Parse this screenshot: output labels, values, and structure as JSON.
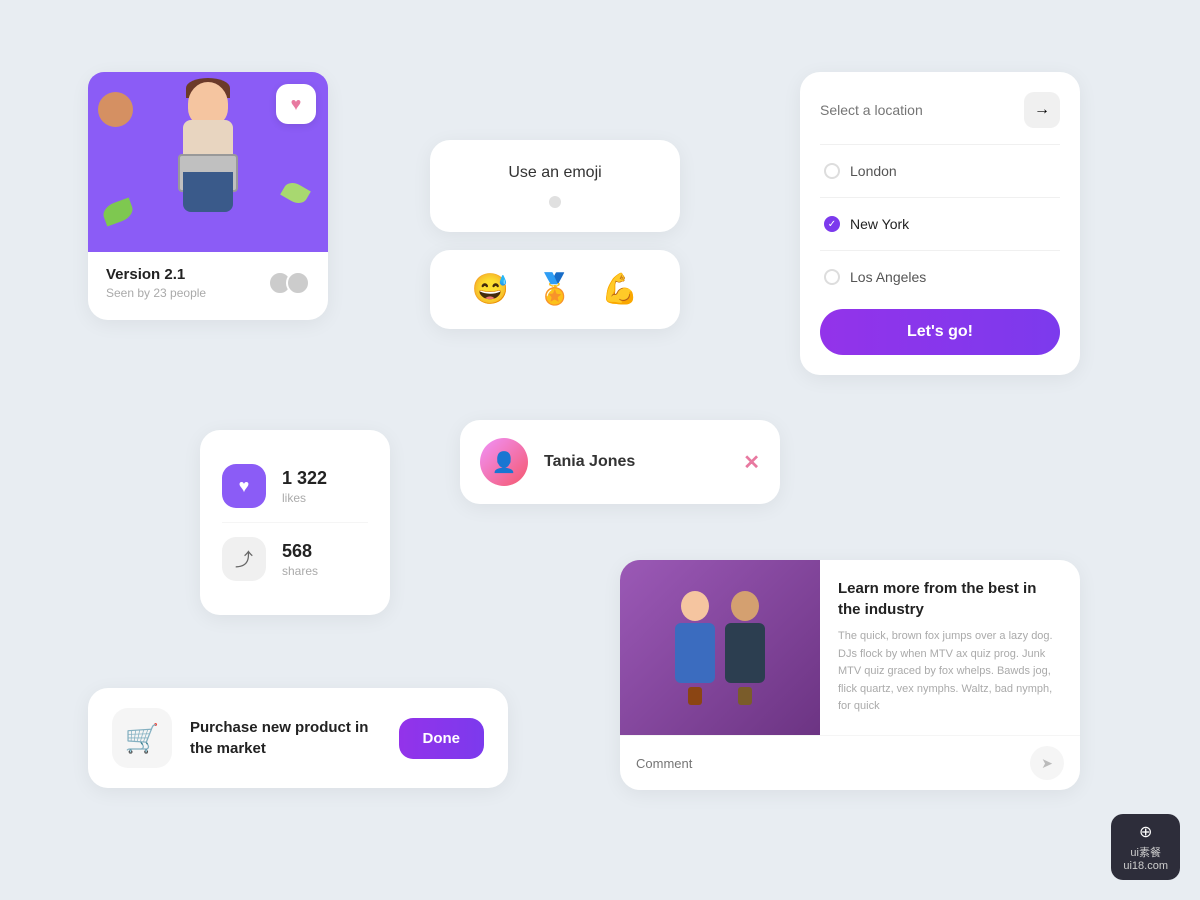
{
  "background": "#e8edf2",
  "version_card": {
    "title": "Version 2.1",
    "subtitle": "Seen by 23 people",
    "heart_emoji": "♥",
    "seen_count": "23"
  },
  "emoji_card": {
    "title": "Use an emoji"
  },
  "emojis": [
    {
      "id": "laugh",
      "symbol": "😅"
    },
    {
      "id": "medal",
      "symbol": "🏅"
    },
    {
      "id": "muscle",
      "symbol": "💪"
    }
  ],
  "location_card": {
    "placeholder": "Select a location",
    "arrow_icon": "→",
    "options": [
      {
        "name": "London",
        "selected": false
      },
      {
        "name": "New York",
        "selected": true
      },
      {
        "name": "Los Angeles",
        "selected": false
      }
    ],
    "button_label": "Let's go!"
  },
  "stats_card": {
    "likes": {
      "count": "1 322",
      "label": "likes",
      "icon": "♥"
    },
    "shares": {
      "count": "568",
      "label": "shares",
      "icon": "⤴"
    }
  },
  "profile_card": {
    "name": "Tania Jones",
    "close_icon": "✕"
  },
  "learn_card": {
    "title": "Learn more from the best in the industry",
    "body_text": "The quick, brown fox jumps over a lazy dog. DJs flock by when MTV ax quiz prog. Junk MTV quiz graced by fox whelps. Bawds jog, flick quartz, vex nymphs. Waltz, bad nymph, for quick",
    "comment_placeholder": "Comment",
    "send_icon": "➤"
  },
  "task_card": {
    "title": "Purchase new product in the market",
    "icon": "🛒",
    "button_label": "Done"
  },
  "watermark": {
    "icon": "⊕",
    "line1": "ui素餐",
    "line2": "ui18.com"
  }
}
